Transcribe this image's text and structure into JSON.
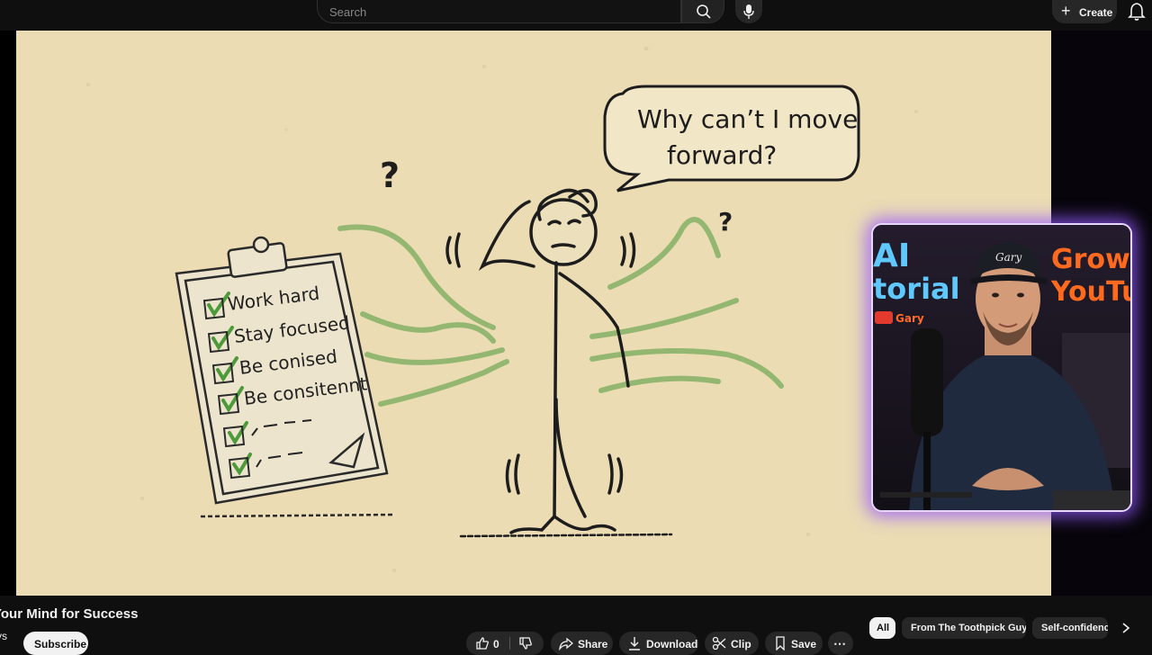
{
  "header": {
    "search_placeholder": "Search",
    "create_label": "Create",
    "icons": [
      "search-icon",
      "mic-icon",
      "plus-icon",
      "bell-icon"
    ]
  },
  "video_frame": {
    "speech_line1": "Why can’t I move",
    "speech_line2": "forward?",
    "checklist": [
      "Work hard",
      "Stay focused",
      "Be conised",
      "Be consitennt"
    ],
    "accent_green": "#4c9a3a",
    "background": "#ebdcb4"
  },
  "webcam_overlay": {
    "neon_left": "AI",
    "neon_left2": "torial",
    "neon_right": "Grow o",
    "neon_right2": "YouTu",
    "cap_text": "Gary",
    "badge_text": "Gary",
    "glow_color": "#9b5cff"
  },
  "below_video": {
    "title": "Your Mind for Success",
    "channel_fragment": "ys",
    "subscribe_label": "Subscribe",
    "like_count": "0",
    "share_label": "Share",
    "download_label": "Download",
    "clip_label": "Clip",
    "save_label": "Save",
    "more_label": "⋯"
  },
  "chips": [
    {
      "label": "All",
      "active": true
    },
    {
      "label": "From The Toothpick Guys",
      "active": false
    },
    {
      "label": "Self-confidence",
      "active": false
    }
  ]
}
